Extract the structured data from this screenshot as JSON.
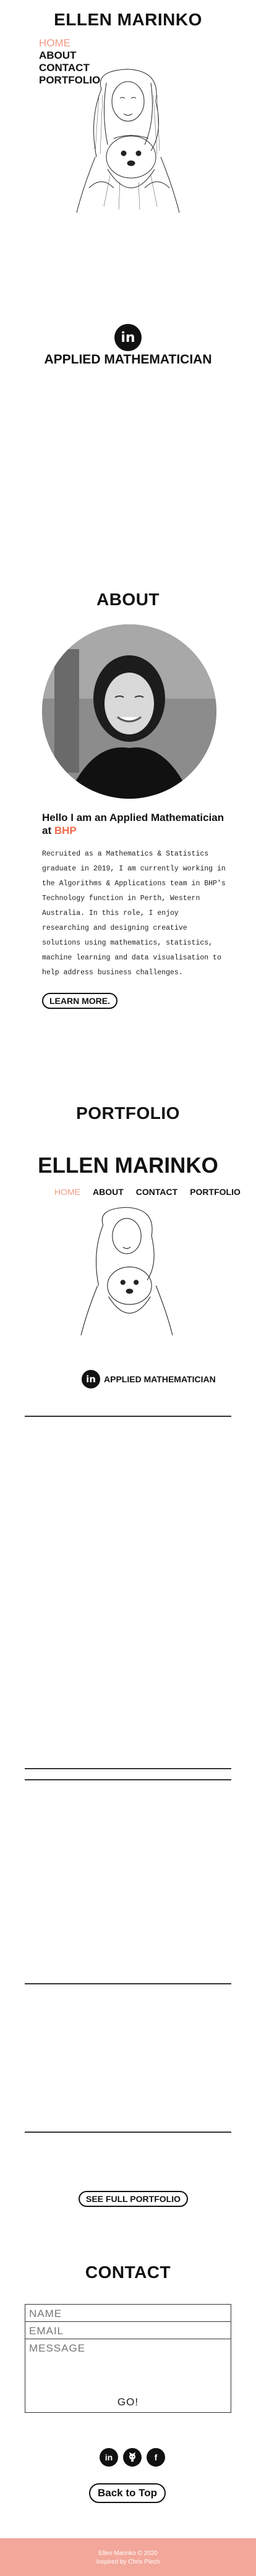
{
  "brand": "ELLEN MARINKO",
  "nav": {
    "home": "HOME",
    "about": "ABOUT",
    "contact": "CONTACT",
    "portfolio": "PORTFOLIO"
  },
  "hero": {
    "linkedin_glyph": "in",
    "tagline": "APPLIED MATHEMATICIAN"
  },
  "about": {
    "heading": "ABOUT",
    "intro_prefix": "Hello I am an Applied Mathematician at ",
    "intro_company": "BHP",
    "body": "Recruited as a Mathematics & Statistics graduate in 2019, I am currently working in the Algorithms & Applications team in BHP's Technology function in Perth, Western Australia. In this role, I enjoy researching and designing creative solutions using mathematics, statistics, machine learning and data visualisation to help address business challenges.",
    "learn_more": "LEARN MORE."
  },
  "portfolio": {
    "heading": "PORTFOLIO",
    "embed_brand": "ELLEN MARINKO",
    "embed_nav": [
      "HOME",
      "ABOUT",
      "CONTACT",
      "PORTFOLIO"
    ],
    "embed_tagline": "APPLIED MATHEMATICIAN",
    "see_full": "SEE FULL PORTFOLIO"
  },
  "contact": {
    "heading": "CONTACT",
    "name_placeholder": "NAME",
    "email_placeholder": "EMAIL",
    "message_placeholder": "MESSAGE",
    "submit": "GO!"
  },
  "social": [
    "linkedin-icon",
    "github-icon",
    "facebook-icon"
  ],
  "back_to_top": "Back to Top",
  "footer": {
    "line1": "Ellen Marinko © 2020",
    "line2": "Inspired by Chris Piech"
  },
  "colors": {
    "accent": "#f29a84",
    "highlight": "#ef6a4a",
    "footer_bg": "#f3a79a"
  }
}
